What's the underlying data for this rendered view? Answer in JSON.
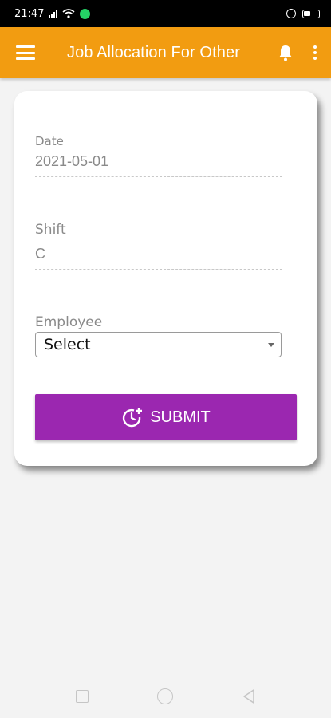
{
  "status_bar": {
    "time": "21:47"
  },
  "app_bar": {
    "title": "Job Allocation For Other",
    "color": "#f29c11",
    "menu_icon": "hamburger-icon",
    "notification_icon": "bell-icon",
    "more_icon": "more-vert-icon"
  },
  "form": {
    "date": {
      "label": "Date",
      "value": "2021-05-01"
    },
    "shift": {
      "label": "Shift",
      "value": "C"
    },
    "employee": {
      "label": "Employee",
      "selected": "Select"
    },
    "submit": {
      "label": "SUBMIT",
      "icon": "clock-plus-icon",
      "color": "#9b27b0"
    }
  },
  "nav_bar": {
    "recents_icon": "square-icon",
    "home_icon": "circle-icon",
    "back_icon": "triangle-back-icon"
  }
}
